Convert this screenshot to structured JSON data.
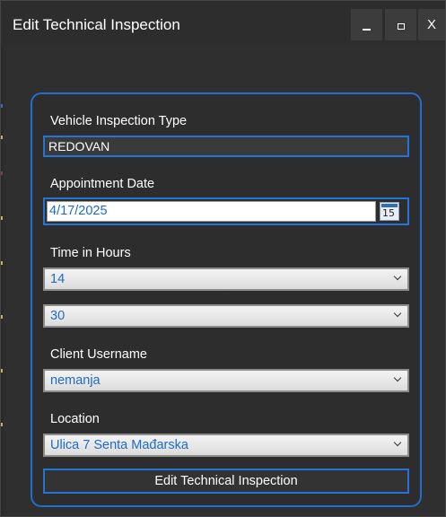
{
  "window": {
    "title": "Edit Technical Inspection",
    "controls": {
      "minimize": "_",
      "maximize": "□",
      "close": "X"
    }
  },
  "form": {
    "inspection_type": {
      "label": "Vehicle Inspection Type",
      "value": "REDOVAN"
    },
    "appointment_date": {
      "label": "Appointment Date",
      "value": "4/17/2025",
      "calendar_day": "15"
    },
    "time": {
      "label": "Time in Hours",
      "hours": "14",
      "minutes": "30"
    },
    "client": {
      "label": "Client Username",
      "value": "nemanja"
    },
    "location": {
      "label": "Location",
      "value": "Ulica 7 Senta Mađarska"
    },
    "submit_label": "Edit Technical Inspection"
  },
  "colors": {
    "accent": "#2274d8",
    "background": "#2f2f2f",
    "text": "#ffffff",
    "value_text": "#1e6cc8"
  }
}
